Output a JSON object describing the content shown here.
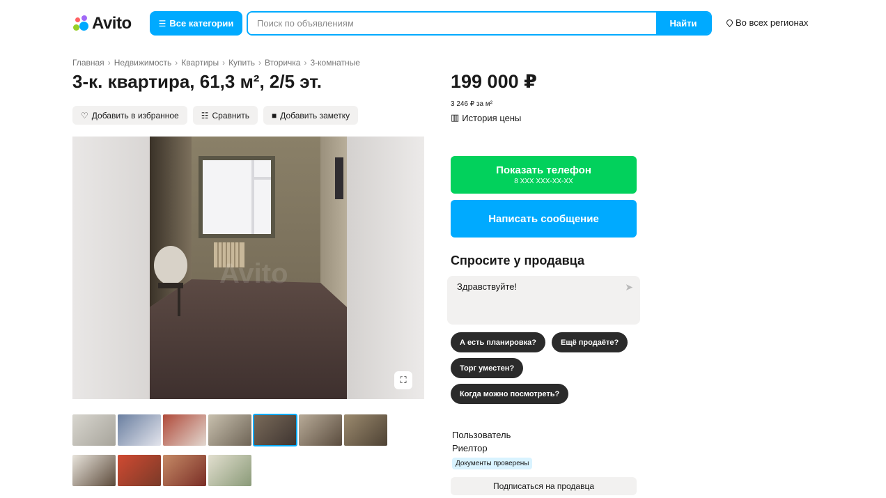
{
  "header": {
    "logo_text": "Avito",
    "categories_label": "Все категории",
    "search_placeholder": "Поиск по объявлениям",
    "search_button": "Найти",
    "region_label": "Во всех регионах"
  },
  "breadcrumb": [
    "Главная",
    "Недвижимость",
    "Квартиры",
    "Купить",
    "Вторичка",
    "3-комнатные"
  ],
  "listing": {
    "title": "3-к. квартира, 61,3 м², 2/5 эт.",
    "actions": {
      "favorite": "Добавить в избранное",
      "compare": "Сравнить",
      "note": "Добавить заметку"
    },
    "gallery": {
      "selected_index": 4,
      "thumbnails": [
        {
          "colors": [
            "#d8d6cf",
            "#a7a49b"
          ]
        },
        {
          "colors": [
            "#6a7fa0",
            "#e3e4ec"
          ]
        },
        {
          "colors": [
            "#b04a3a",
            "#e2d8d0"
          ]
        },
        {
          "colors": [
            "#c8c0ae",
            "#6e6456"
          ]
        },
        {
          "colors": [
            "#7a6b5a",
            "#3e3430"
          ]
        },
        {
          "colors": [
            "#b8ab98",
            "#5a4c3e"
          ]
        },
        {
          "colors": [
            "#9b8a6e",
            "#4e4234"
          ]
        },
        {
          "colors": [
            "#e8e4dc",
            "#5c4a3a"
          ]
        },
        {
          "colors": [
            "#d04a32",
            "#7a3a28"
          ]
        },
        {
          "colors": [
            "#c58a66",
            "#7a2e26"
          ]
        },
        {
          "colors": [
            "#e2dfcf",
            "#8a9a78"
          ]
        }
      ]
    }
  },
  "pricing": {
    "price": "199 000 ₽",
    "per_m2": "3 246 ₽ за м²",
    "history_label": "История цены"
  },
  "contact": {
    "show_phone": "Показать телефон",
    "phone_mask": "8 XXX XXX-XX-XX",
    "write_message": "Написать сообщение"
  },
  "ask": {
    "title": "Спросите у продавца",
    "message_value": "Здравствуйте!",
    "quick_questions": [
      "А есть планировка?",
      "Ещё продаёте?",
      "Торг уместен?",
      "Когда можно посмотреть?"
    ]
  },
  "seller": {
    "role": "Пользователь",
    "type": "Риелтор",
    "badge": "Документы проверены",
    "subscribe": "Подписаться на продавца"
  },
  "colors": {
    "accent_blue": "#00aaff",
    "accent_green": "#02d15c",
    "chip_dark": "#2b2b2b",
    "soft_gray": "#f2f1f0"
  }
}
